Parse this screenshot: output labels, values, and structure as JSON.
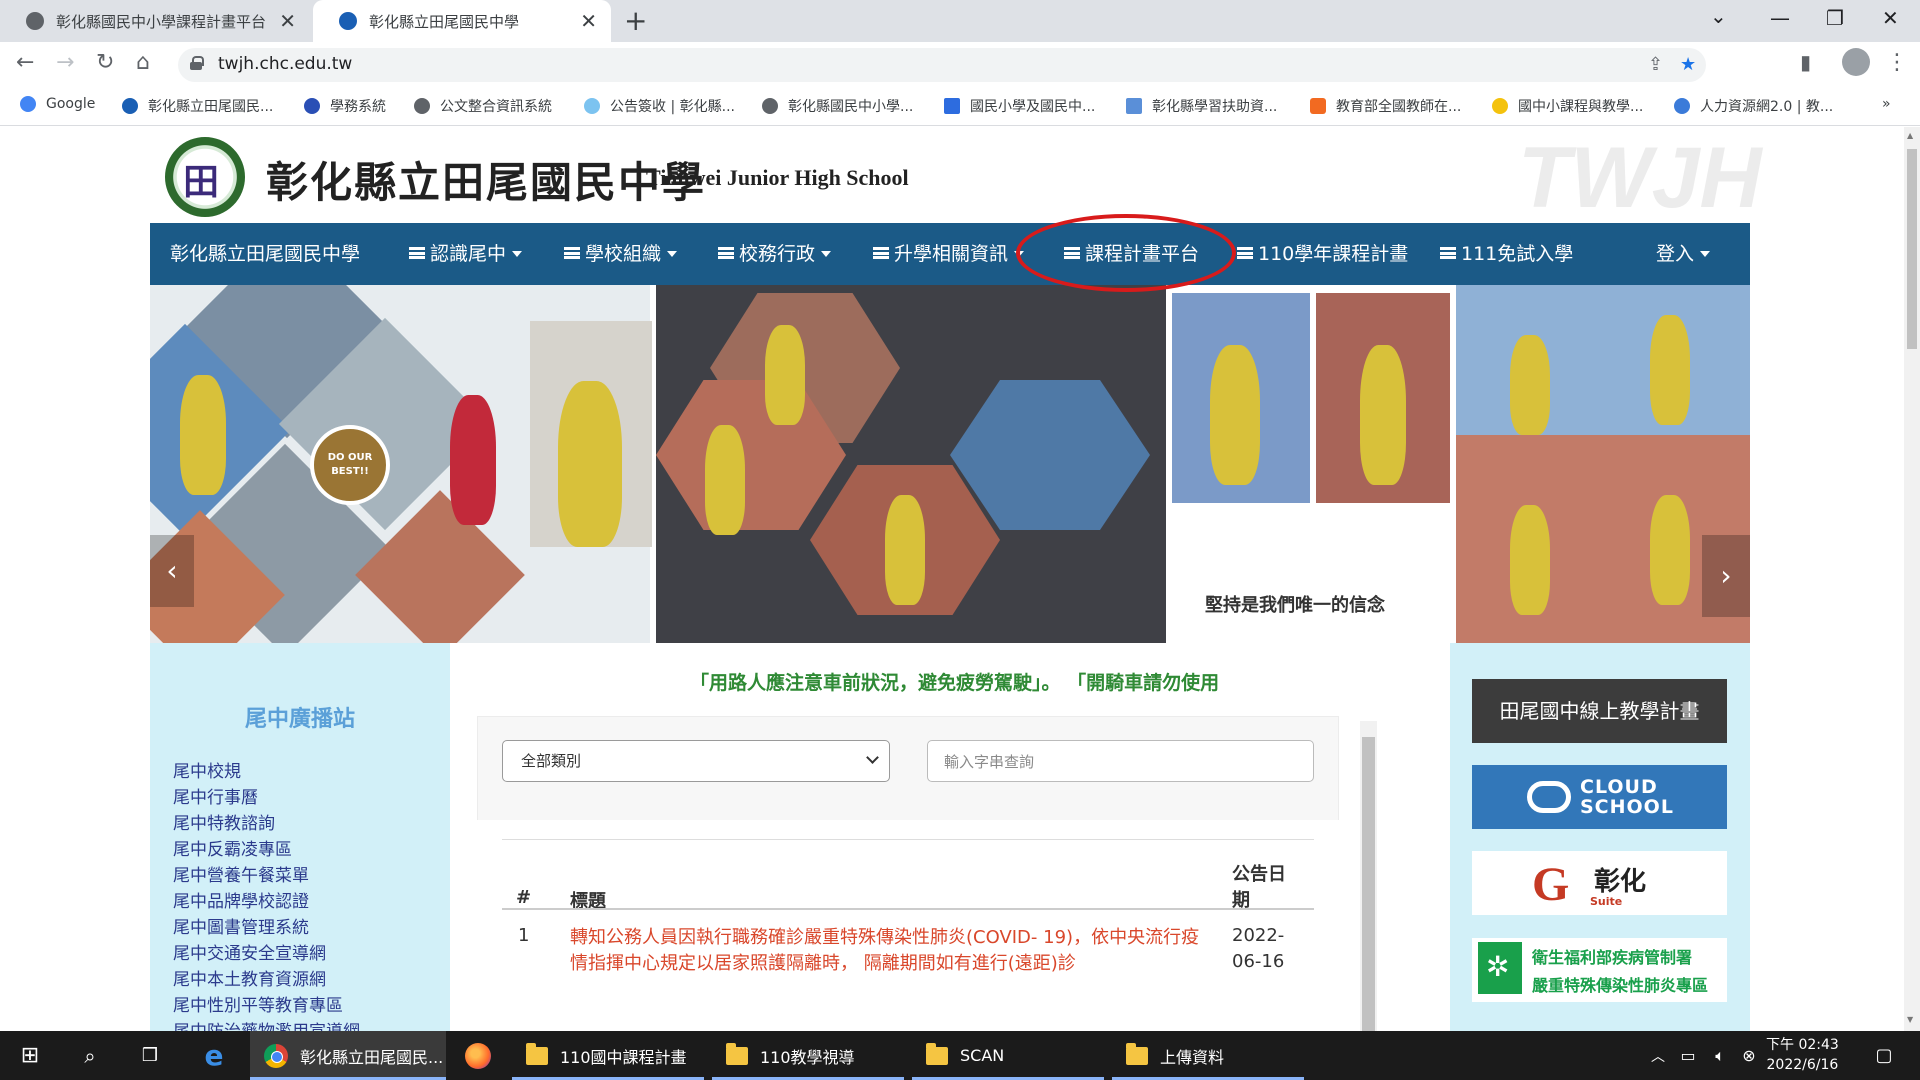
{
  "browser": {
    "tabs": [
      {
        "title": "彰化縣國民中小學課程計畫平台",
        "active": false
      },
      {
        "title": "彰化縣立田尾國民中學",
        "active": true
      }
    ],
    "url": "twjh.chc.edu.tw",
    "bookmarks": [
      "Google",
      "彰化縣立田尾國民...",
      "學務系統",
      "公文整合資訊系統",
      "公告簽收 | 彰化縣...",
      "彰化縣國民中小學...",
      "國民小學及國民中...",
      "彰化縣學習扶助資...",
      "教育部全國教師在...",
      "國中小課程與教學...",
      "人力資源網2.0 | 教..."
    ]
  },
  "site": {
    "name_cn": "彰化縣立田尾國民中學",
    "name_en": "Tianwei Junior High School",
    "watermark": "TWJH",
    "nav": [
      {
        "label": "彰化縣立田尾國民中學",
        "menu_icon": false,
        "caret": false
      },
      {
        "label": "認識尾中",
        "menu_icon": true,
        "caret": true
      },
      {
        "label": "學校組織",
        "menu_icon": true,
        "caret": true
      },
      {
        "label": "校務行政",
        "menu_icon": true,
        "caret": true
      },
      {
        "label": "升學相關資訊",
        "menu_icon": true,
        "caret": true
      },
      {
        "label": "課程計畫平台",
        "menu_icon": true,
        "caret": false
      },
      {
        "label": "110學年課程計畫",
        "menu_icon": true,
        "caret": false
      },
      {
        "label": "111免試入學",
        "menu_icon": true,
        "caret": false
      },
      {
        "label": "登入",
        "menu_icon": false,
        "caret": true
      }
    ],
    "banner": {
      "badge": "DO OUR BEST!!",
      "motto": "堅持是我們唯一的信念"
    }
  },
  "left_sidebar": {
    "title": "尾中廣播站",
    "links": [
      "尾中校規",
      "尾中行事曆",
      "尾中特教諮詢",
      "尾中反霸凌專區",
      "尾中營養午餐菜單",
      "尾中品牌學校認證",
      "尾中圖書管理系統",
      "尾中交通安全宣導網",
      "尾中本土教育資源網",
      "尾中性別平等教育專區",
      "尾中防治藥物濫用宣導網"
    ]
  },
  "main": {
    "marquee": "「用路人應注意車前狀況，避免疲勞駕駛」。 「開騎車請勿使用",
    "category_select": "全部類別",
    "search_placeholder": "輸入字串查詢",
    "table": {
      "headers": {
        "num": "#",
        "title": "標題",
        "date_line1": "公告日",
        "date_line2": "期"
      },
      "rows": [
        {
          "num": "1",
          "title": "轉知公務人員因執行職務確診嚴重特殊傳染性肺炎(COVID- 19)，依中央流行疫情指揮中心規定以居家照護隔離時， 隔離期間如有進行(遠距)診",
          "date_line1": "2022-",
          "date_line2": "06-16"
        }
      ]
    }
  },
  "right_sidebar": {
    "btn_online": "田尾國中線上教學計畫",
    "cloud_l1": "CLOUD",
    "cloud_l2": "SCHOOL",
    "gsuite_letter": "G",
    "gsuite_text": "彰化",
    "gsuite_sub": "Suite",
    "cdc_l1": "衛生福利部疾病管制署",
    "cdc_l2": "嚴重特殊傳染性肺炎專區"
  },
  "taskbar": {
    "apps": [
      {
        "label": "彰化縣立田尾國民...",
        "type": "chrome"
      },
      {
        "label": "110國中課程計畫",
        "type": "folder"
      },
      {
        "label": "110教學視導",
        "type": "folder"
      },
      {
        "label": "SCAN",
        "type": "folder"
      },
      {
        "label": "上傳資料",
        "type": "folder"
      }
    ],
    "time": "下午 02:43",
    "date": "2022/6/16"
  },
  "colors": {
    "nav_bg": "#1b5a87",
    "sidebar_bg": "#d2f0f8",
    "highlight": "#d81b1b",
    "notice_title": "#d9472b",
    "marquee": "#2f8a35"
  }
}
